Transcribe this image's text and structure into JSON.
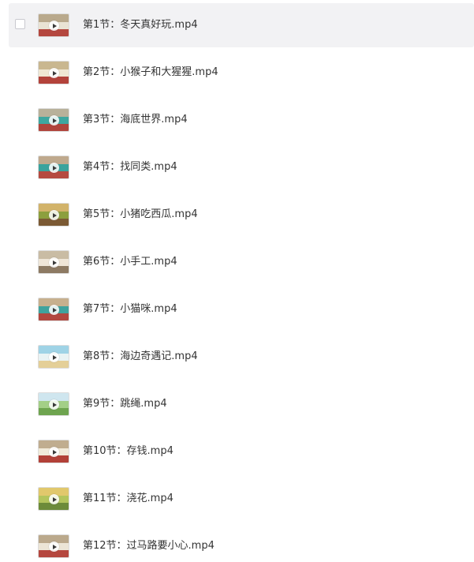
{
  "files": [
    {
      "name": "第1节：冬天真好玩.mp4",
      "thumb_colors": [
        "#b9a98c",
        "#e9e3d4",
        "#b4473f"
      ],
      "hovered": true
    },
    {
      "name": "第2节：小猴子和大猩猩.mp4",
      "thumb_colors": [
        "#c9b790",
        "#f0e7d3",
        "#b3433b"
      ],
      "hovered": false
    },
    {
      "name": "第3节：海底世界.mp4",
      "thumb_colors": [
        "#b8b19a",
        "#3ea7a0",
        "#b0443c"
      ],
      "hovered": false
    },
    {
      "name": "第4节：找同类.mp4",
      "thumb_colors": [
        "#bfa98d",
        "#3aa39d",
        "#b54a40"
      ],
      "hovered": false
    },
    {
      "name": "第5节：小猪吃西瓜.mp4",
      "thumb_colors": [
        "#d2b36a",
        "#8c9f3e",
        "#7b5a34"
      ],
      "hovered": false
    },
    {
      "name": "第6节：小手工.mp4",
      "thumb_colors": [
        "#c9bca4",
        "#efe6d8",
        "#8d7a63"
      ],
      "hovered": false
    },
    {
      "name": "第7节：小猫咪.mp4",
      "thumb_colors": [
        "#c7b08e",
        "#3fa39e",
        "#b2473f"
      ],
      "hovered": false
    },
    {
      "name": "第8节：海边奇遇记.mp4",
      "thumb_colors": [
        "#9fd3e6",
        "#e9f3f4",
        "#e4cf98"
      ],
      "hovered": false
    },
    {
      "name": "第9节：跳绳.mp4",
      "thumb_colors": [
        "#cfe6ef",
        "#a3cf87",
        "#6ea44f"
      ],
      "hovered": false
    },
    {
      "name": "第10节：存钱.mp4",
      "thumb_colors": [
        "#c0ad8f",
        "#f1ead9",
        "#b24138"
      ],
      "hovered": false
    },
    {
      "name": "第11节：浇花.mp4",
      "thumb_colors": [
        "#e1c86c",
        "#b3c55d",
        "#6c8b3a"
      ],
      "hovered": false
    },
    {
      "name": "第12节：过马路要小心.mp4",
      "thumb_colors": [
        "#bba98c",
        "#ece5d6",
        "#b5473f"
      ],
      "hovered": false
    }
  ]
}
